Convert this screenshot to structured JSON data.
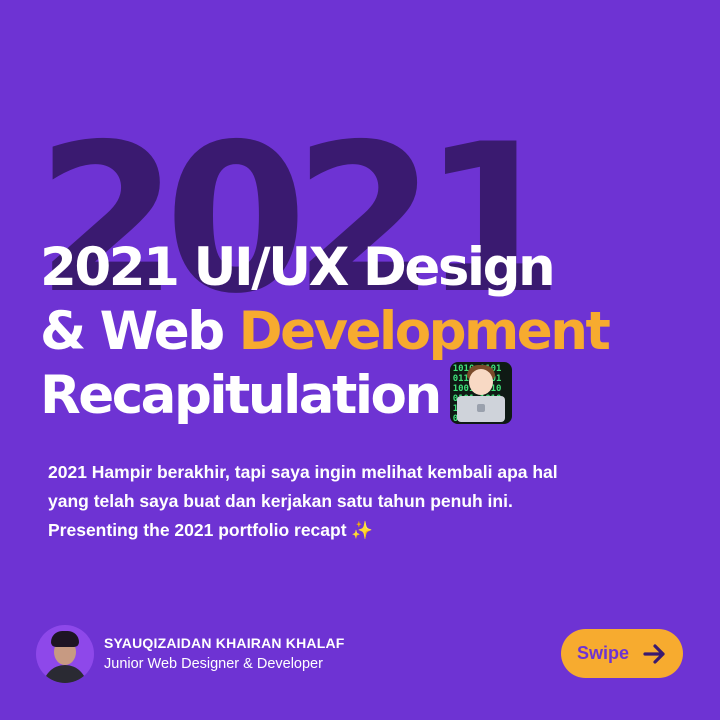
{
  "background_year": "2021",
  "headline": {
    "line1": "2021 UI/UX Design",
    "line2_prefix": "& Web ",
    "line2_accent": "Development",
    "line3": "Recapitulation",
    "emoji_icon": "technologist-icon"
  },
  "intro": {
    "line1": "2021 Hampir berakhir, tapi saya ingin melihat kembali apa hal",
    "line2": "yang telah saya buat dan kerjakan satu tahun penuh ini.",
    "line3": "Presenting the 2021 portfolio recapt",
    "sparkle_icon": "sparkles-icon"
  },
  "author": {
    "name": "SYAUQIZAIDAN KHAIRAN KHALAF",
    "role": "Junior Web Designer & Developer"
  },
  "swipe_button": {
    "label": "Swipe",
    "icon": "arrow-right-icon"
  },
  "colors": {
    "background": "#6e33d3",
    "background_text": "#3a1a70",
    "accent": "#f7ab2f",
    "text": "#ffffff"
  }
}
